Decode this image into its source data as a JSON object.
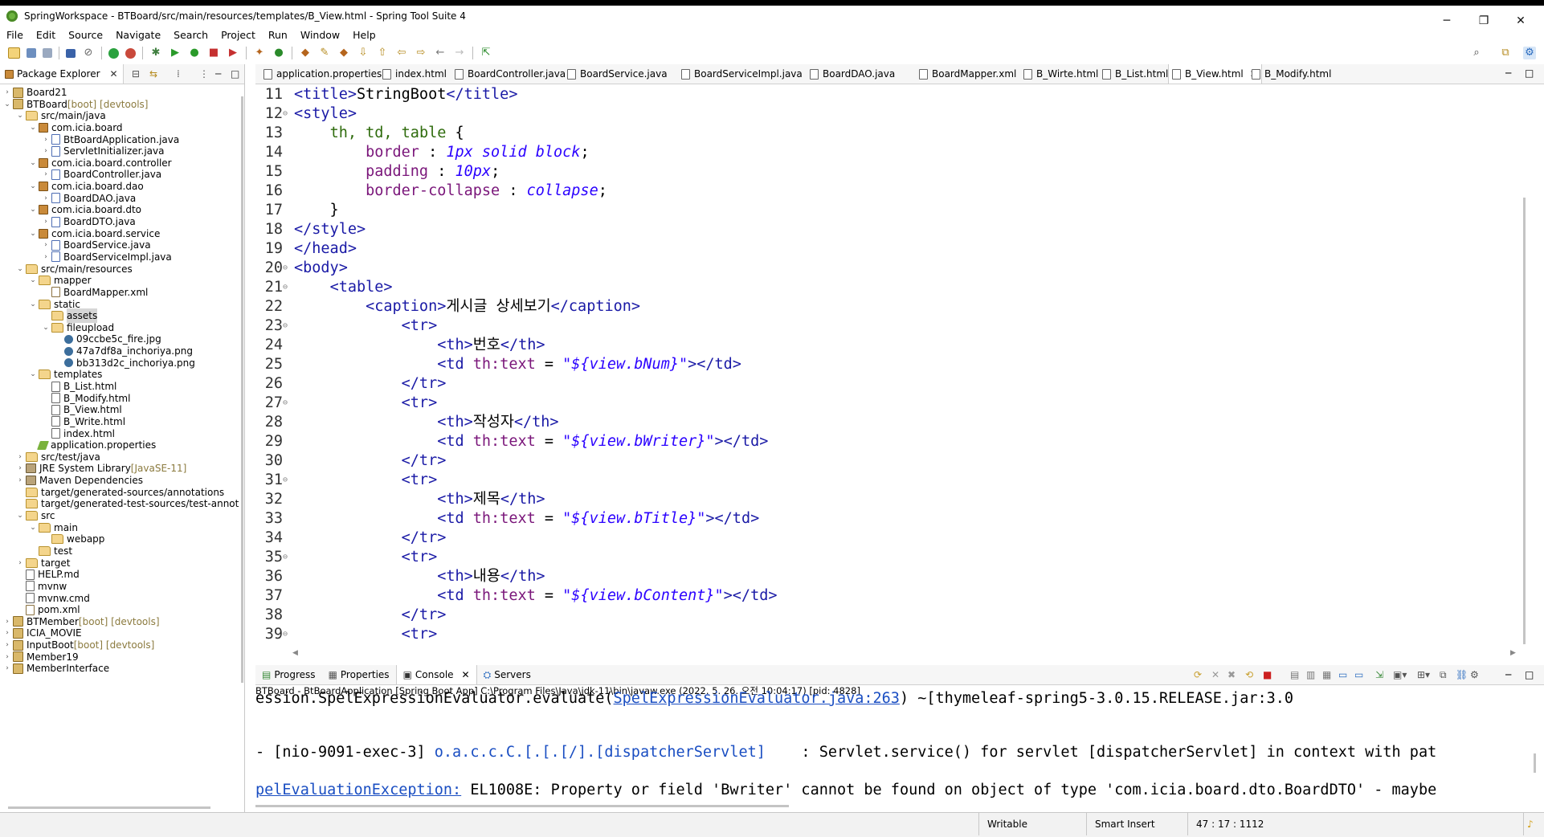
{
  "window": {
    "title": "SpringWorkspace - BTBoard/src/main/resources/templates/B_View.html - Spring Tool Suite 4",
    "minimize": "─",
    "maximize": "❐",
    "close": "✕"
  },
  "menu": [
    "File",
    "Edit",
    "Source",
    "Navigate",
    "Search",
    "Project",
    "Run",
    "Window",
    "Help"
  ],
  "explorer": {
    "tab_label": "Package Explorer",
    "items": [
      {
        "label": "Board21",
        "deco": "",
        "depth": 0,
        "twisty": "›",
        "icon": "proj"
      },
      {
        "label": "BTBoard",
        "deco": " [boot] [devtools]",
        "depth": 0,
        "twisty": "⌄",
        "icon": "proj"
      },
      {
        "label": "src/main/java",
        "deco": "",
        "depth": 1,
        "twisty": "⌄",
        "icon": "folder"
      },
      {
        "label": "com.icia.board",
        "deco": "",
        "depth": 2,
        "twisty": "⌄",
        "icon": "pkg"
      },
      {
        "label": "BtBoardApplication.java",
        "deco": "",
        "depth": 3,
        "twisty": "›",
        "icon": "java"
      },
      {
        "label": "ServletInitializer.java",
        "deco": "",
        "depth": 3,
        "twisty": "›",
        "icon": "java"
      },
      {
        "label": "com.icia.board.controller",
        "deco": "",
        "depth": 2,
        "twisty": "⌄",
        "icon": "pkg"
      },
      {
        "label": "BoardController.java",
        "deco": "",
        "depth": 3,
        "twisty": "›",
        "icon": "java"
      },
      {
        "label": "com.icia.board.dao",
        "deco": "",
        "depth": 2,
        "twisty": "⌄",
        "icon": "pkg"
      },
      {
        "label": "BoardDAO.java",
        "deco": "",
        "depth": 3,
        "twisty": "›",
        "icon": "java"
      },
      {
        "label": "com.icia.board.dto",
        "deco": "",
        "depth": 2,
        "twisty": "⌄",
        "icon": "pkg"
      },
      {
        "label": "BoardDTO.java",
        "deco": "",
        "depth": 3,
        "twisty": "›",
        "icon": "java"
      },
      {
        "label": "com.icia.board.service",
        "deco": "",
        "depth": 2,
        "twisty": "⌄",
        "icon": "pkg"
      },
      {
        "label": "BoardService.java",
        "deco": "",
        "depth": 3,
        "twisty": "›",
        "icon": "java"
      },
      {
        "label": "BoardServiceImpl.java",
        "deco": "",
        "depth": 3,
        "twisty": "›",
        "icon": "java"
      },
      {
        "label": "src/main/resources",
        "deco": "",
        "depth": 1,
        "twisty": "⌄",
        "icon": "folder"
      },
      {
        "label": "mapper",
        "deco": "",
        "depth": 2,
        "twisty": "⌄",
        "icon": "folder"
      },
      {
        "label": "BoardMapper.xml",
        "deco": "",
        "depth": 3,
        "twisty": "",
        "icon": "xml"
      },
      {
        "label": "static",
        "deco": "",
        "depth": 2,
        "twisty": "⌄",
        "icon": "folder"
      },
      {
        "label": "assets",
        "deco": "",
        "depth": 3,
        "twisty": "",
        "icon": "folder",
        "selected": true
      },
      {
        "label": "fileupload",
        "deco": "",
        "depth": 3,
        "twisty": "⌄",
        "icon": "folder"
      },
      {
        "label": "09ccbe5c_fire.jpg",
        "deco": "",
        "depth": 4,
        "twisty": "",
        "icon": "img"
      },
      {
        "label": "47a7df8a_inchoriya.png",
        "deco": "",
        "depth": 4,
        "twisty": "",
        "icon": "img"
      },
      {
        "label": "bb313d2c_inchoriya.png",
        "deco": "",
        "depth": 4,
        "twisty": "",
        "icon": "img"
      },
      {
        "label": "templates",
        "deco": "",
        "depth": 2,
        "twisty": "⌄",
        "icon": "folder"
      },
      {
        "label": "B_List.html",
        "deco": "",
        "depth": 3,
        "twisty": "",
        "icon": "html"
      },
      {
        "label": "B_Modify.html",
        "deco": "",
        "depth": 3,
        "twisty": "",
        "icon": "html"
      },
      {
        "label": "B_View.html",
        "deco": "",
        "depth": 3,
        "twisty": "",
        "icon": "html"
      },
      {
        "label": "B_Write.html",
        "deco": "",
        "depth": 3,
        "twisty": "",
        "icon": "html"
      },
      {
        "label": "index.html",
        "deco": "",
        "depth": 3,
        "twisty": "",
        "icon": "html"
      },
      {
        "label": "application.properties",
        "deco": "",
        "depth": 2,
        "twisty": "",
        "icon": "prop"
      },
      {
        "label": "src/test/java",
        "deco": "",
        "depth": 1,
        "twisty": "›",
        "icon": "folder"
      },
      {
        "label": "JRE System Library",
        "deco": " [JavaSE-11]",
        "depth": 1,
        "twisty": "›",
        "icon": "lib"
      },
      {
        "label": "Maven Dependencies",
        "deco": "",
        "depth": 1,
        "twisty": "›",
        "icon": "lib"
      },
      {
        "label": "target/generated-sources/annotations",
        "deco": "",
        "depth": 1,
        "twisty": "",
        "icon": "folder"
      },
      {
        "label": "target/generated-test-sources/test-annotatic",
        "deco": "",
        "depth": 1,
        "twisty": "",
        "icon": "folder"
      },
      {
        "label": "src",
        "deco": "",
        "depth": 1,
        "twisty": "⌄",
        "icon": "folder"
      },
      {
        "label": "main",
        "deco": "",
        "depth": 2,
        "twisty": "⌄",
        "icon": "folder"
      },
      {
        "label": "webapp",
        "deco": "",
        "depth": 3,
        "twisty": "",
        "icon": "folder"
      },
      {
        "label": "test",
        "deco": "",
        "depth": 2,
        "twisty": "",
        "icon": "folder"
      },
      {
        "label": "target",
        "deco": "",
        "depth": 1,
        "twisty": "›",
        "icon": "folder"
      },
      {
        "label": "HELP.md",
        "deco": "",
        "depth": 1,
        "twisty": "",
        "icon": "html"
      },
      {
        "label": "mvnw",
        "deco": "",
        "depth": 1,
        "twisty": "",
        "icon": "html"
      },
      {
        "label": "mvnw.cmd",
        "deco": "",
        "depth": 1,
        "twisty": "",
        "icon": "html"
      },
      {
        "label": "pom.xml",
        "deco": "",
        "depth": 1,
        "twisty": "",
        "icon": "xml"
      },
      {
        "label": "BTMember",
        "deco": " [boot] [devtools]",
        "depth": 0,
        "twisty": "›",
        "icon": "proj"
      },
      {
        "label": "ICIA_MOVIE",
        "deco": "",
        "depth": 0,
        "twisty": "›",
        "icon": "proj"
      },
      {
        "label": "InputBoot",
        "deco": " [boot] [devtools]",
        "depth": 0,
        "twisty": "›",
        "icon": "proj"
      },
      {
        "label": "Member19",
        "deco": "",
        "depth": 0,
        "twisty": "›",
        "icon": "proj"
      },
      {
        "label": "MemberInterface",
        "deco": "",
        "depth": 0,
        "twisty": "›",
        "icon": "proj"
      }
    ]
  },
  "editor_tabs": [
    "application.properties",
    "index.html",
    "BoardController.java",
    "BoardService.java",
    "BoardServiceImpl.java",
    "BoardDAO.java",
    "BoardMapper.xml",
    "B_Wirte.html",
    "B_List.html",
    "B_View.html",
    "B_Modify.html"
  ],
  "active_tab": "B_View.html",
  "code_lines": [
    {
      "n": "11",
      "fold": "",
      "segs": [
        [
          "tag",
          "<title>"
        ],
        [
          "black",
          "StringBoot"
        ],
        [
          "tag",
          "</title>"
        ]
      ]
    },
    {
      "n": "12",
      "fold": "⊖",
      "segs": [
        [
          "tag",
          "<style>"
        ]
      ]
    },
    {
      "n": "13",
      "fold": "",
      "segs": [
        [
          "black",
          "    "
        ],
        [
          "css-sel",
          "th, td, table "
        ],
        [
          "black",
          "{"
        ]
      ]
    },
    {
      "n": "14",
      "fold": "",
      "segs": [
        [
          "black",
          "        "
        ],
        [
          "css-prop",
          "border"
        ],
        [
          "black",
          " : "
        ],
        [
          "css-val",
          "1px solid block"
        ],
        [
          "black",
          ";"
        ]
      ]
    },
    {
      "n": "15",
      "fold": "",
      "segs": [
        [
          "black",
          "        "
        ],
        [
          "css-prop",
          "padding"
        ],
        [
          "black",
          " : "
        ],
        [
          "css-val",
          "10px"
        ],
        [
          "black",
          ";"
        ]
      ]
    },
    {
      "n": "16",
      "fold": "",
      "segs": [
        [
          "black",
          "        "
        ],
        [
          "css-prop",
          "border-collapse"
        ],
        [
          "black",
          " : "
        ],
        [
          "css-val",
          "collapse"
        ],
        [
          "black",
          ";"
        ]
      ]
    },
    {
      "n": "17",
      "fold": "",
      "segs": [
        [
          "black",
          "    }"
        ]
      ]
    },
    {
      "n": "18",
      "fold": "",
      "segs": [
        [
          "tag",
          "</style>"
        ]
      ]
    },
    {
      "n": "19",
      "fold": "",
      "segs": [
        [
          "tag",
          "</head>"
        ]
      ]
    },
    {
      "n": "20",
      "fold": "⊖",
      "segs": [
        [
          "tag",
          "<body>"
        ]
      ]
    },
    {
      "n": "21",
      "fold": "⊖",
      "segs": [
        [
          "black",
          "    "
        ],
        [
          "tag",
          "<table>"
        ]
      ]
    },
    {
      "n": "22",
      "fold": "",
      "segs": [
        [
          "black",
          "        "
        ],
        [
          "tag",
          "<caption>"
        ],
        [
          "black",
          "게시글 상세보기"
        ],
        [
          "tag",
          "</caption>"
        ]
      ]
    },
    {
      "n": "23",
      "fold": "⊖",
      "segs": [
        [
          "black",
          "            "
        ],
        [
          "tag",
          "<tr>"
        ]
      ]
    },
    {
      "n": "24",
      "fold": "",
      "segs": [
        [
          "black",
          "                "
        ],
        [
          "tag",
          "<th>"
        ],
        [
          "black",
          "번호"
        ],
        [
          "tag",
          "</th>"
        ]
      ]
    },
    {
      "n": "25",
      "fold": "",
      "segs": [
        [
          "black",
          "                "
        ],
        [
          "tag",
          "<td "
        ],
        [
          "attr",
          "th:text"
        ],
        [
          "black",
          " = "
        ],
        [
          "str",
          "\"${view.bNum}\""
        ],
        [
          "tag",
          "></td>"
        ]
      ]
    },
    {
      "n": "26",
      "fold": "",
      "segs": [
        [
          "black",
          "            "
        ],
        [
          "tag",
          "</tr>"
        ]
      ]
    },
    {
      "n": "27",
      "fold": "⊖",
      "segs": [
        [
          "black",
          "            "
        ],
        [
          "tag",
          "<tr>"
        ]
      ]
    },
    {
      "n": "28",
      "fold": "",
      "segs": [
        [
          "black",
          "                "
        ],
        [
          "tag",
          "<th>"
        ],
        [
          "black",
          "작성자"
        ],
        [
          "tag",
          "</th>"
        ]
      ]
    },
    {
      "n": "29",
      "fold": "",
      "segs": [
        [
          "black",
          "                "
        ],
        [
          "tag",
          "<td "
        ],
        [
          "attr",
          "th:text"
        ],
        [
          "black",
          " = "
        ],
        [
          "str",
          "\"${view.bWriter}\""
        ],
        [
          "tag",
          "></td>"
        ]
      ]
    },
    {
      "n": "30",
      "fold": "",
      "segs": [
        [
          "black",
          "            "
        ],
        [
          "tag",
          "</tr>"
        ]
      ]
    },
    {
      "n": "31",
      "fold": "⊖",
      "segs": [
        [
          "black",
          "            "
        ],
        [
          "tag",
          "<tr>"
        ]
      ]
    },
    {
      "n": "32",
      "fold": "",
      "segs": [
        [
          "black",
          "                "
        ],
        [
          "tag",
          "<th>"
        ],
        [
          "black",
          "제목"
        ],
        [
          "tag",
          "</th>"
        ]
      ]
    },
    {
      "n": "33",
      "fold": "",
      "segs": [
        [
          "black",
          "                "
        ],
        [
          "tag",
          "<td "
        ],
        [
          "attr",
          "th:text"
        ],
        [
          "black",
          " = "
        ],
        [
          "str",
          "\"${view.bTitle}\""
        ],
        [
          "tag",
          "></td>"
        ]
      ]
    },
    {
      "n": "34",
      "fold": "",
      "segs": [
        [
          "black",
          "            "
        ],
        [
          "tag",
          "</tr>"
        ]
      ]
    },
    {
      "n": "35",
      "fold": "⊖",
      "segs": [
        [
          "black",
          "            "
        ],
        [
          "tag",
          "<tr>"
        ]
      ]
    },
    {
      "n": "36",
      "fold": "",
      "segs": [
        [
          "black",
          "                "
        ],
        [
          "tag",
          "<th>"
        ],
        [
          "black",
          "내용"
        ],
        [
          "tag",
          "</th>"
        ]
      ]
    },
    {
      "n": "37",
      "fold": "",
      "segs": [
        [
          "black",
          "                "
        ],
        [
          "tag",
          "<td "
        ],
        [
          "attr",
          "th:text"
        ],
        [
          "black",
          " = "
        ],
        [
          "str",
          "\"${view.bContent}\""
        ],
        [
          "tag",
          "></td>"
        ]
      ]
    },
    {
      "n": "38",
      "fold": "",
      "segs": [
        [
          "black",
          "            "
        ],
        [
          "tag",
          "</tr>"
        ]
      ]
    },
    {
      "n": "39",
      "fold": "⊖",
      "segs": [
        [
          "black",
          "            "
        ],
        [
          "tag",
          "<tr>"
        ]
      ]
    }
  ],
  "console": {
    "tabs": [
      "Progress",
      "Properties",
      "Console",
      "Servers"
    ],
    "active": "Console",
    "description": "BTBoard - BtBoardApplication [Spring Boot App] C:\\Program Files\\Java\\jdk-11\\bin\\javaw.exe  (2022. 5. 26. 오전 10:04:17) [pid: 4828]",
    "line1_prefix": "ession.SpelExpressionEvaluator.evaluate(",
    "line1_link": "SpelExpressionEvaluator.java:263",
    "line1_suffix": ") ~[thymeleaf-spring5-3.0.15.RELEASE.jar:3.0",
    "line2_prefix": "- [nio-9091-exec-3] ",
    "line2_logger": "o.a.c.c.C.[.[.[/].[dispatcherServlet]",
    "line2_suffix": "    : Servlet.service() for servlet [dispatcherServlet] in context with pat",
    "line3_link": "pelEvaluationException:",
    "line3_suffix": " EL1008E: Property or field 'Bwriter' cannot be found on object of type 'com.icia.board.dto.BoardDTO' - maybe"
  },
  "status": {
    "writable": "Writable",
    "insert_mode": "Smart Insert",
    "position": "47 : 17 : 1112"
  }
}
